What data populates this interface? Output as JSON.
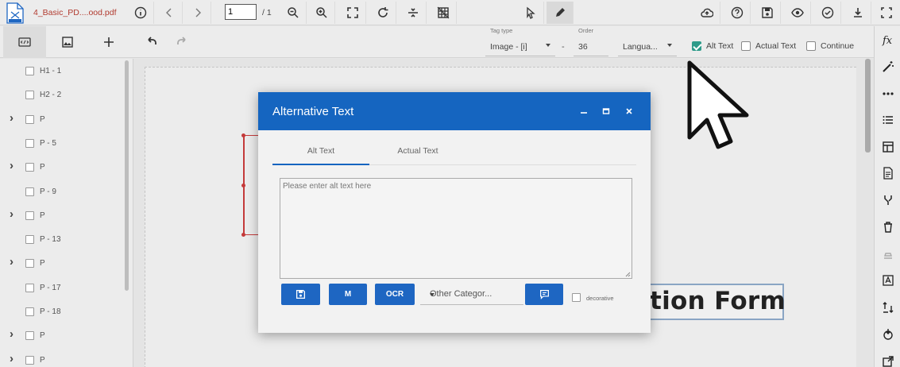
{
  "file": {
    "name": "4_Basic_PD....ood.pdf"
  },
  "pager": {
    "current": "1",
    "total": "/ 1"
  },
  "tag": {
    "type_label": "Tag type",
    "type_value": "Image - [i]",
    "order_label": "Order",
    "order_value": "36",
    "separator": "-",
    "language_value": "Langua..."
  },
  "options": {
    "alt_text": "Alt Text",
    "actual_text": "Actual Text",
    "continue": "Continue",
    "alt_text_checked": true,
    "actual_text_checked": false,
    "continue_checked": false
  },
  "tree": {
    "items": [
      {
        "label": "H1 - 1",
        "expandable": false
      },
      {
        "label": "H2 - 2",
        "expandable": false
      },
      {
        "label": "P",
        "expandable": true
      },
      {
        "label": "P - 5",
        "expandable": false
      },
      {
        "label": "P",
        "expandable": true
      },
      {
        "label": "P - 9",
        "expandable": false
      },
      {
        "label": "P",
        "expandable": true
      },
      {
        "label": "P - 13",
        "expandable": false
      },
      {
        "label": "P",
        "expandable": true
      },
      {
        "label": "P - 17",
        "expandable": false
      },
      {
        "label": "P - 18",
        "expandable": false
      },
      {
        "label": "P",
        "expandable": true
      },
      {
        "label": "P",
        "expandable": true
      }
    ]
  },
  "document": {
    "heading_fragment": "tion Form"
  },
  "modal": {
    "title": "Alternative Text",
    "tabs": [
      "Alt Text",
      "Actual Text"
    ],
    "textarea_placeholder": "Please enter alt text here",
    "m_button": "M",
    "ocr_button": "OCR",
    "category_value": "Other Categor...",
    "decorative_label": "decorative"
  },
  "colors": {
    "accent": "#1565c0",
    "button": "#1e66c2",
    "check": "#2e9b8a",
    "file_name": "#b13a2f",
    "selection": "#c43a3a"
  },
  "icons": {
    "top": [
      "file-pdf-icon",
      "info-icon",
      "chevron-left-icon",
      "chevron-right-icon",
      "zoom-out-icon",
      "zoom-in-icon",
      "fit-page-icon",
      "rotate-icon",
      "split-icon",
      "grid-off-icon",
      "pointer-icon",
      "pen-icon",
      "cloud-upload-icon",
      "help-icon",
      "save-icon",
      "eye-icon",
      "check-circle-icon",
      "download-icon",
      "fullscreen-icon"
    ],
    "right": [
      "function-icon",
      "magic-wand-icon",
      "more-icon",
      "list-icon",
      "table-icon",
      "document-icon",
      "merge-icon",
      "trash-icon",
      "stamp-icon",
      "text-box-icon",
      "reorder-icon",
      "anchor-icon",
      "export-icon"
    ]
  }
}
